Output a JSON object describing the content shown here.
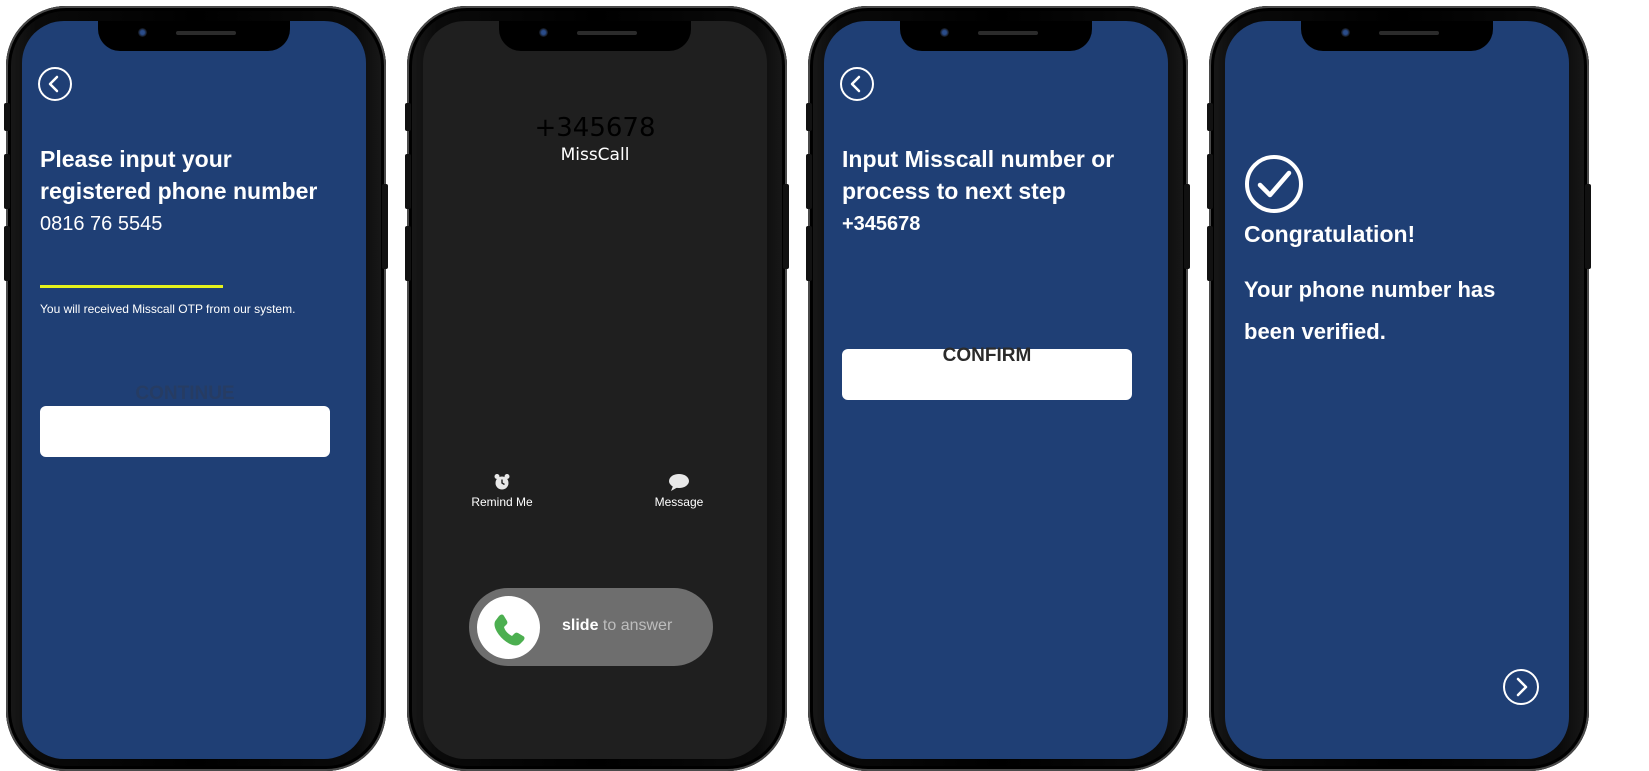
{
  "screen1": {
    "title_line1": "Please input your",
    "title_line2": "registered phone number",
    "phone_value": "0816 76 5545",
    "hint": "You will received Misscall OTP from our system.",
    "continue_label": "CONTINUE",
    "underline_color": "#e4f21b"
  },
  "screen2": {
    "caller_number": "+345678",
    "caller_name": "MissCall",
    "remind_label": "Remind Me",
    "message_label": "Message",
    "slide_bold": "slide",
    "slide_rest": " to answer"
  },
  "screen3": {
    "title_line1": "Input Misscall number or",
    "title_line2": "process to next step",
    "number": "+345678",
    "confirm_label": "CONFIRM"
  },
  "screen4": {
    "congrats": "Congratulation!",
    "message_line1": "Your phone number has",
    "message_line2": "been verified."
  },
  "colors": {
    "screen_blue": "#1f3f75",
    "call_bg": "#1f1f1f",
    "phone_green": "#4caf50"
  }
}
